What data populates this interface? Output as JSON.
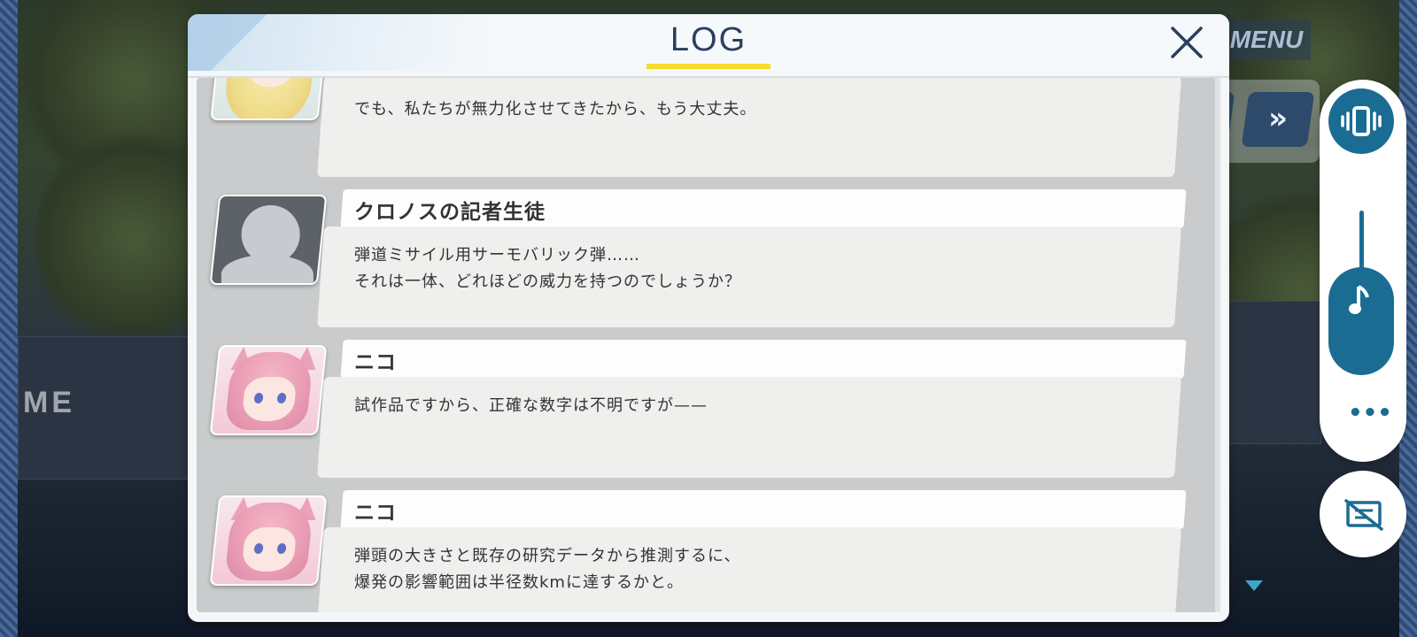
{
  "background": {
    "sign_text": "ME",
    "menu_label": "MENU",
    "fast_forward_icon": "double-chevron-right-icon"
  },
  "log": {
    "title": "LOG",
    "close_icon": "close-icon",
    "accent_color": "#f4dc2a",
    "entries": [
      {
        "speaker": "",
        "avatar": "blonde-girl",
        "lines": [
          "でも、私たちが無力化させてきたから、もう大丈夫。"
        ]
      },
      {
        "speaker": "クロノスの記者生徒",
        "avatar": "generic-silhouette",
        "lines": [
          "弾道ミサイル用サーモバリック弾……",
          "それは一体、どれほどの威力を持つのでしょうか？"
        ]
      },
      {
        "speaker": "ニコ",
        "avatar": "pink-cat-girl",
        "lines": [
          "試作品ですから、正確な数字は不明ですが——"
        ]
      },
      {
        "speaker": "ニコ",
        "avatar": "pink-cat-girl",
        "lines": [
          "弾頭の大きさと既存の研究データから推測するに、",
          "爆発の影響範囲は半径数kmに達するかと。"
        ]
      }
    ]
  },
  "controls": {
    "vibration_icon": "vibration-icon",
    "music_icon": "music-note-icon",
    "more_icon": "more-dots-icon",
    "more_glyph": "•••",
    "auto_icon": "hide-text-icon",
    "music_volume": 0.35,
    "control_color": "#1b6c93"
  }
}
